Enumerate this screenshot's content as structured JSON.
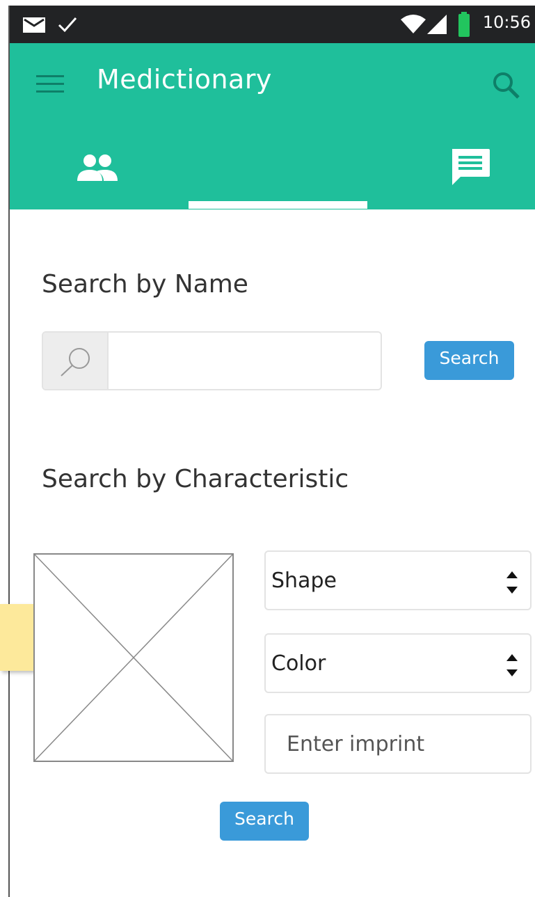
{
  "status_bar": {
    "time": "10:56",
    "icons": [
      "mail-icon",
      "check-icon",
      "wifi-icon",
      "signal-icon",
      "battery-icon"
    ]
  },
  "app_bar": {
    "title": "Medictionary",
    "icons": [
      "menu-icon",
      "search-icon"
    ]
  },
  "tabs": [
    {
      "icon": "people-icon",
      "active": false
    },
    {
      "icon": "",
      "active": true
    },
    {
      "icon": "chat-icon",
      "active": false
    }
  ],
  "search_by_name": {
    "title": "Search by Name",
    "input_value": "",
    "button_label": "Search"
  },
  "search_by_characteristic": {
    "title": "Search by Characteristic",
    "shape_select": "Shape",
    "color_select": "Color",
    "imprint_placeholder": "Enter imprint",
    "button_label": "Search"
  },
  "colors": {
    "accent": "#1fbf9b",
    "status_bar": "#222325",
    "button": "#3a9ad9",
    "sticky_note": "#fde99b"
  }
}
